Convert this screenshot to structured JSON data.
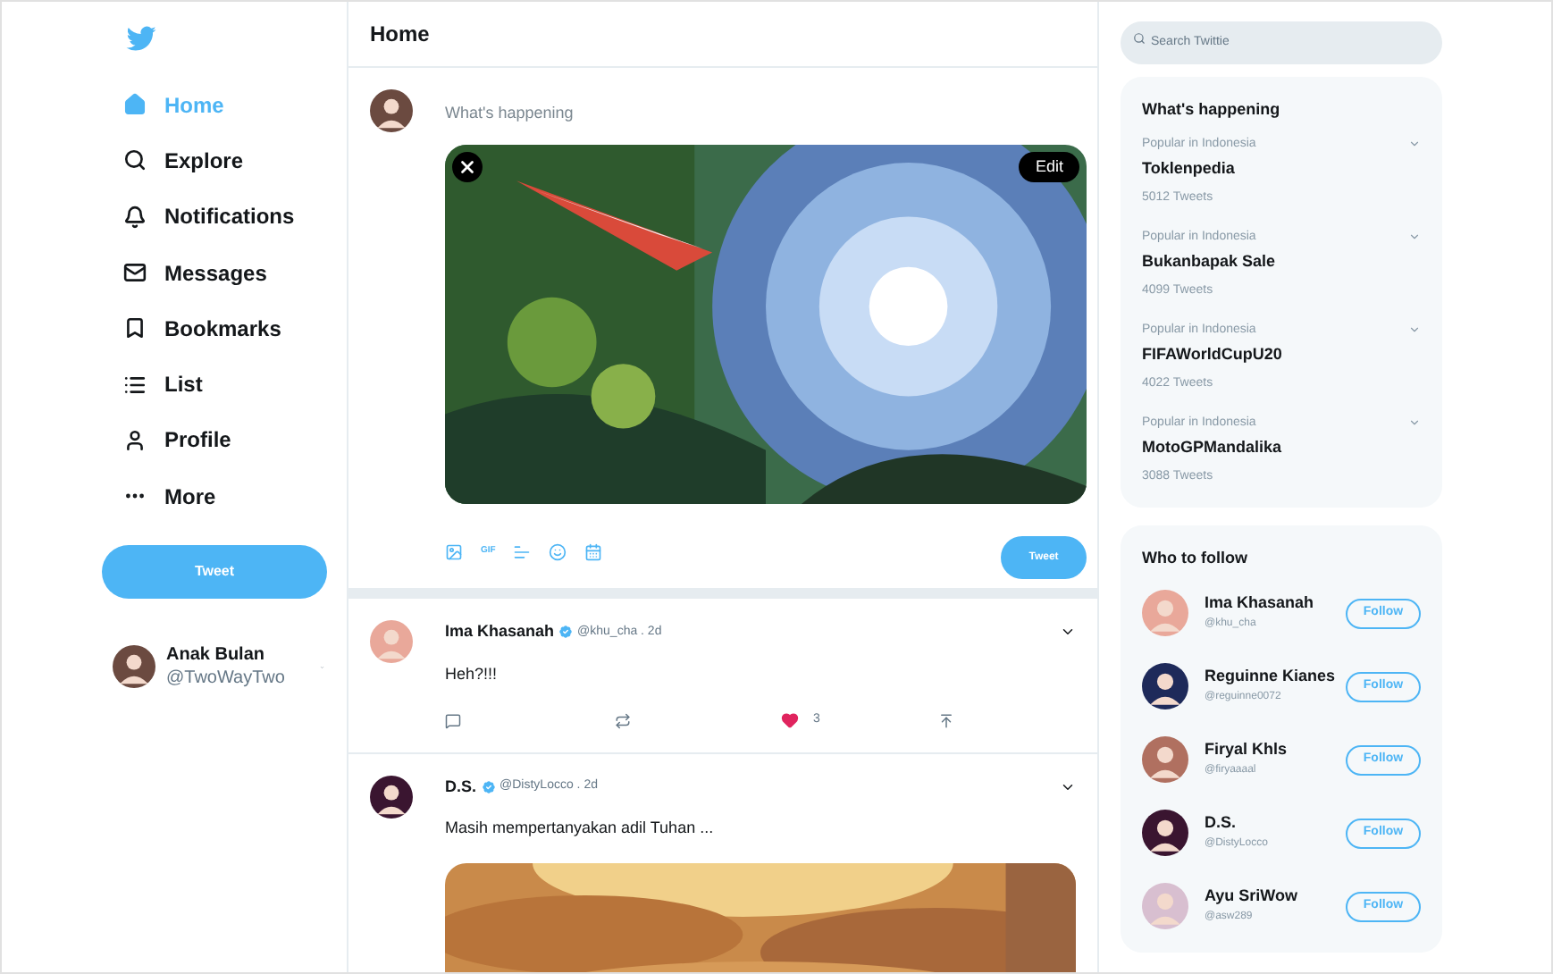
{
  "sidebar": {
    "items": [
      {
        "label": "Home",
        "selected": true
      },
      {
        "label": "Explore",
        "selected": false
      },
      {
        "label": "Notifications",
        "selected": false
      },
      {
        "label": "Messages",
        "selected": false
      },
      {
        "label": "Bookmarks",
        "selected": false
      },
      {
        "label": "List",
        "selected": false
      },
      {
        "label": "Profile",
        "selected": false
      },
      {
        "label": "More",
        "selected": false
      }
    ],
    "tweet_button": "Tweet",
    "account": {
      "name": "Anak Bulan",
      "handle": "@TwoWayTwo"
    }
  },
  "header": {
    "title": "Home"
  },
  "composer": {
    "placeholder": "What's happening",
    "edit_button": "Edit",
    "gif_label": "GIF",
    "tweet_button": "Tweet"
  },
  "tweets": [
    {
      "name": "Ima Khasanah",
      "verified": true,
      "handle": "@khu_cha . 2d",
      "text": "Heh?!!!",
      "liked": true,
      "likes": "3",
      "kind": "text"
    },
    {
      "name": "D.S.",
      "verified": true,
      "handle": "@DistyLocco . 2d",
      "text": "Masih mempertanyakan adil Tuhan ..."
    }
  ],
  "search": {
    "placeholder": "Search Twittie"
  },
  "trends": {
    "title": "What's happening",
    "items": [
      {
        "context": "Popular in Indonesia",
        "topic": "Toklenpedia",
        "count": "5012 Tweets"
      },
      {
        "context": "Popular in Indonesia",
        "topic": "Bukanbapak Sale",
        "count": "4099 Tweets"
      },
      {
        "context": "Popular in Indonesia",
        "topic": "FIFAWorldCupU20",
        "count": "4022 Tweets"
      },
      {
        "context": "Popular in Indonesia",
        "topic": "MotoGPMandalika",
        "count": "3088 Tweets"
      }
    ]
  },
  "who_to_follow": {
    "title": "Who to follow",
    "items": [
      {
        "name": "Ima Khasanah",
        "handle": "@khu_cha",
        "button": "Follow"
      },
      {
        "name": "Reguinne Kianes",
        "handle": "@reguinne0072",
        "button": "Follow"
      },
      {
        "name": "Firyal Khls",
        "handle": "@firyaaaal",
        "button": "Follow"
      },
      {
        "name": "D.S.",
        "handle": "@DistyLocco",
        "button": "Follow"
      },
      {
        "name": "Ayu SriWow",
        "handle": "@asw289",
        "button": "Follow"
      }
    ]
  }
}
